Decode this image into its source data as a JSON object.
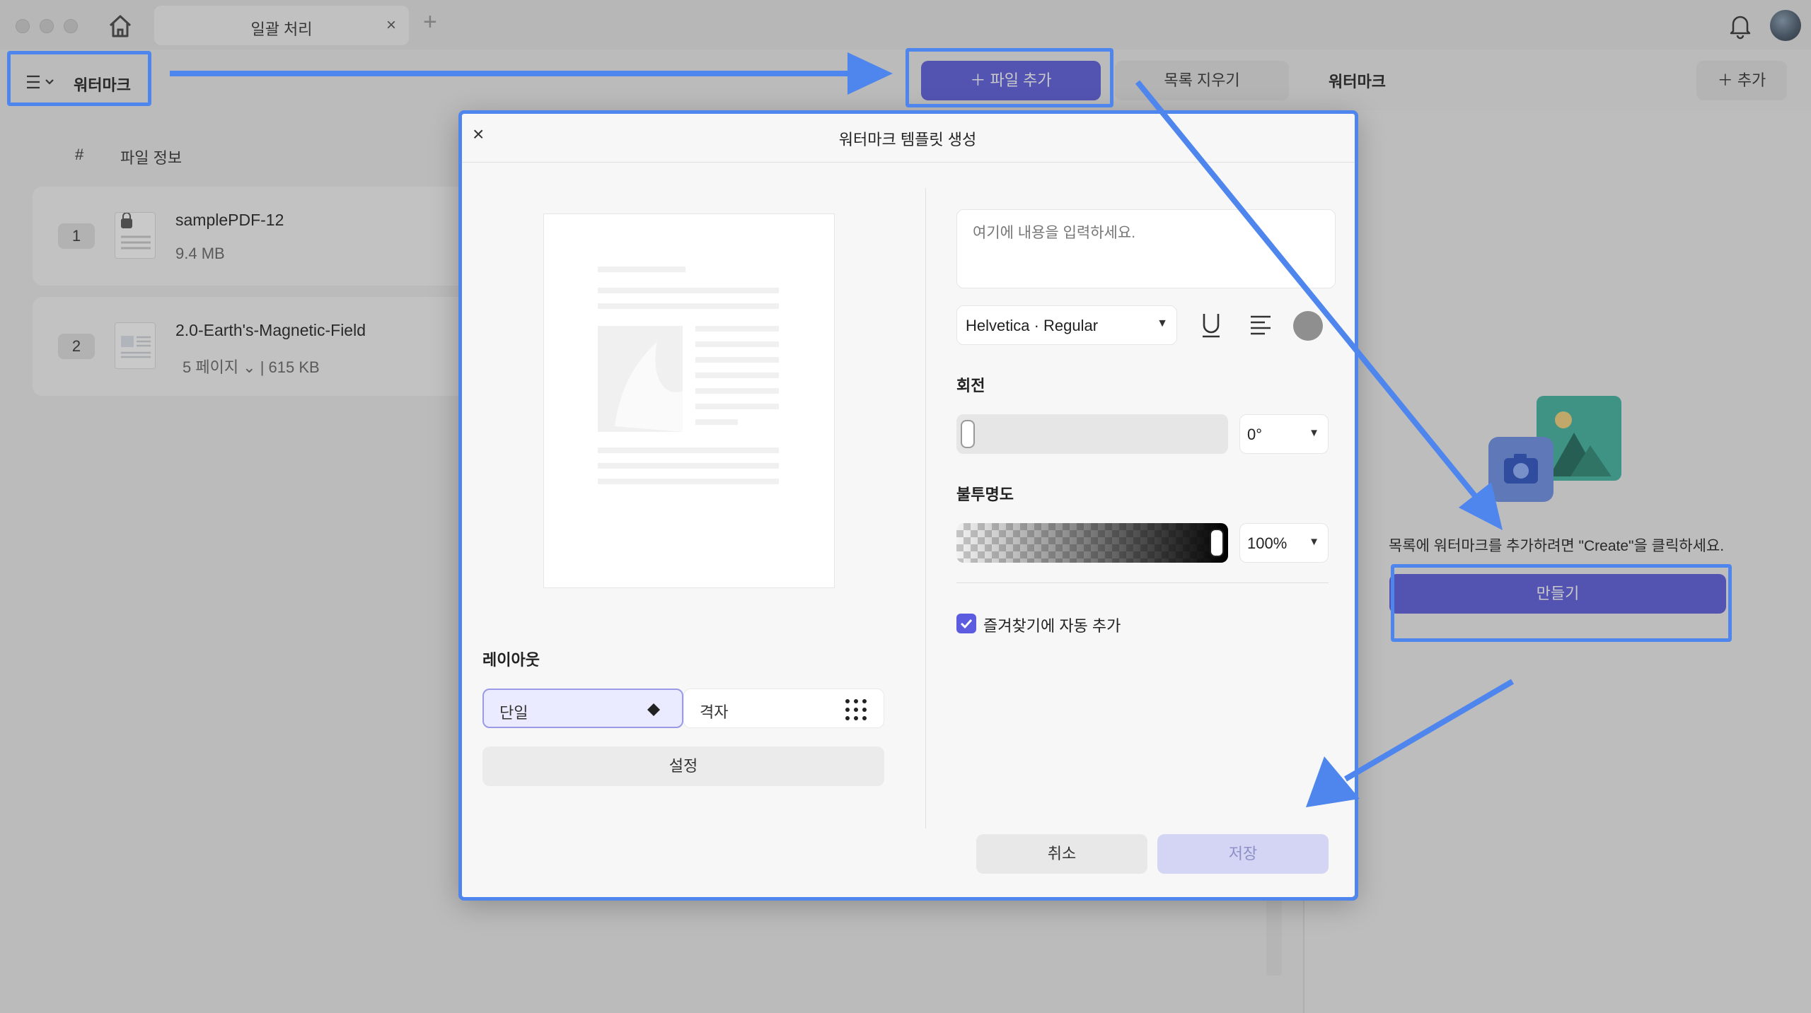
{
  "window": {
    "tab_title": "일괄 처리",
    "tab_close": "×",
    "tab_add": "+"
  },
  "toolbar": {
    "menu_label": "워터마크",
    "add_file_label": "＋ 파일 추가",
    "clear_list_label": "목록 지우기",
    "panel_title": "워터마크",
    "panel_add_label": "＋ 추가"
  },
  "file_list": {
    "header_num": "#",
    "header_info": "파일 정보",
    "files": [
      {
        "num": "1",
        "name": "samplePDF-12",
        "meta": "9.4 MB"
      },
      {
        "num": "2",
        "name": "2.0-Earth's-Magnetic-Field",
        "meta": "5 페이지 ⌄  |  615 KB"
      }
    ]
  },
  "dialog": {
    "close": "×",
    "title": "워터마크 템플릿 생성",
    "text_placeholder": "여기에 내용을 입력하세요.",
    "font": "Helvetica · Regular",
    "rotation_label": "회전",
    "rotation_value": "0°",
    "opacity_label": "불투명도",
    "opacity_value": "100%",
    "opacity_level": 1.0,
    "auto_favorite_label": "즐겨찾기에 자동 추가",
    "auto_favorite_checked": true,
    "layout_label": "레이아웃",
    "layout_single": "단일",
    "layout_grid": "격자",
    "settings_label": "설정",
    "cancel_label": "취소",
    "save_label": "저장"
  },
  "right_panel": {
    "hint": "목록에 워터마크를 추가하려면 \"Create\"을 클릭하세요.",
    "create_label": "만들기"
  },
  "colors": {
    "accent": "#5c5ce0",
    "highlight": "#4f86ee"
  }
}
